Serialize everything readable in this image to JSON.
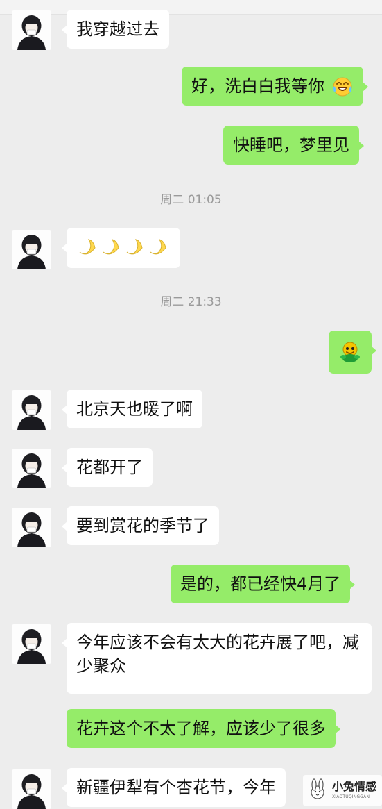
{
  "chat": {
    "timestamps": [
      "周二 01:05",
      "周二 21:33"
    ],
    "messages": [
      "我穿越过去",
      "好，洗白白我等你",
      "快睡吧，梦里见",
      "北京天也暖了啊",
      "花都开了",
      "要到赏花的季节了",
      "是的，都已经快4月了",
      "今年应该不会有太大的花卉展了吧，减少聚众",
      "花卉这个不太了解，应该少了很多",
      "新疆伊犁有个杏花节，今年"
    ],
    "emoji": {
      "laugh": "laughing-tears-emoji",
      "moons": [
        "crescent-moon-emoji",
        "crescent-moon-emoji",
        "crescent-moon-emoji",
        "crescent-moon-emoji"
      ],
      "sticker": "green-bird-sticker"
    }
  },
  "watermark": {
    "text": "小兔情感",
    "subtext": "XIAOTUQINGGAN"
  },
  "colors": {
    "background": "#ededed",
    "incoming_bubble": "#ffffff",
    "outgoing_bubble": "#95ec69",
    "timestamp": "#9a9a9a"
  }
}
